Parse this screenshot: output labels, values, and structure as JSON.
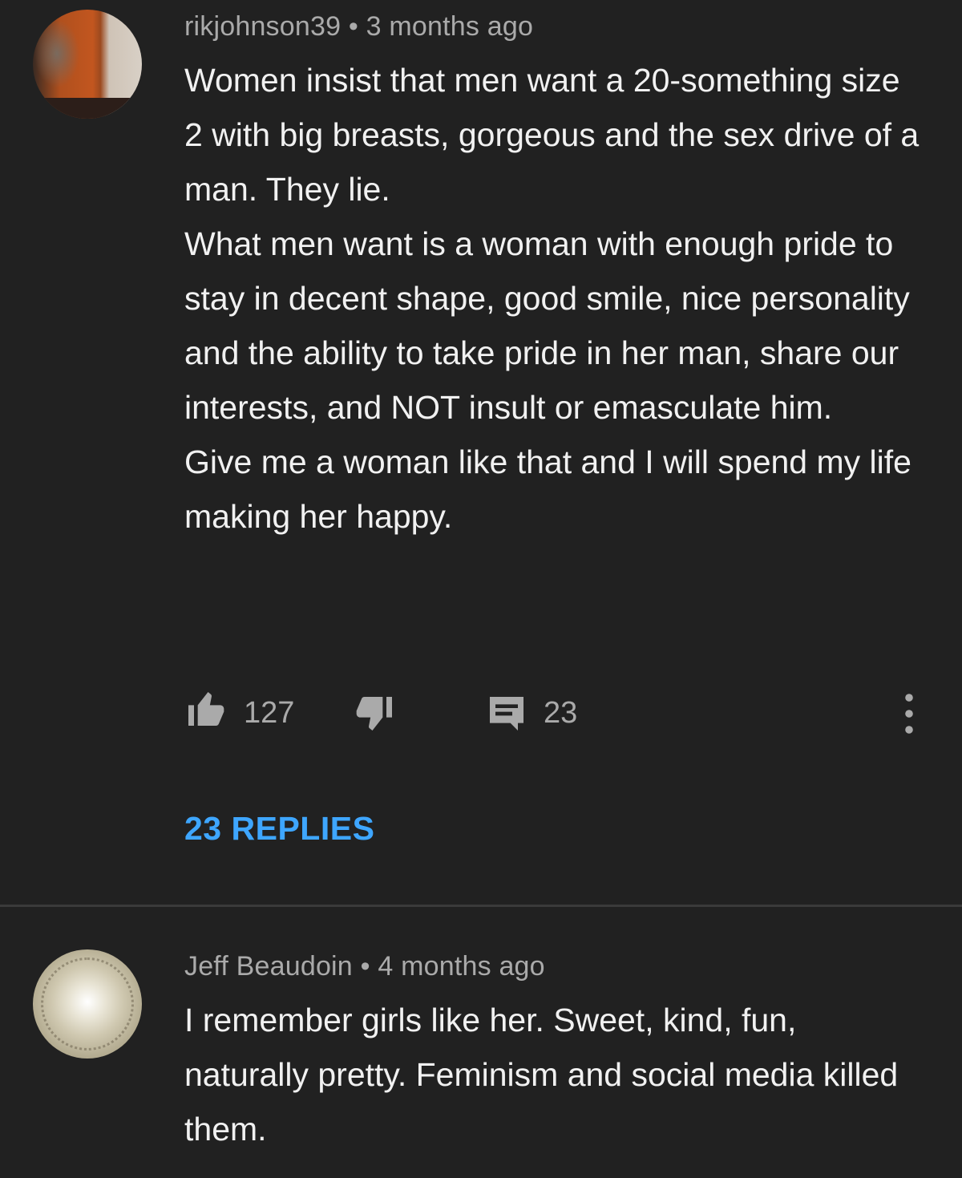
{
  "comments": [
    {
      "author": "rikjohnson39",
      "separator": "•",
      "time": "3 months ago",
      "paragraphs": [
        "Women insist that men want a 20-something size 2 with big breasts, gorgeous and the sex drive of a man.  They lie.",
        "What men want is a woman with enough pride to stay in decent shape, good smile, nice personality and the ability to take pride in her man, share our interests, and NOT insult or emasculate him.",
        "Give me a woman like that and I will spend my life making her happy."
      ],
      "likes": "127",
      "reply_count": "23",
      "replies_label": "23 REPLIES"
    },
    {
      "author": "Jeff Beaudoin",
      "separator": "•",
      "time": "4 months ago",
      "paragraphs": [
        "I remember girls like her. Sweet, kind, fun, naturally pretty. Feminism and social media killed them."
      ]
    }
  ],
  "icons": {
    "like": "thumb-up-icon",
    "dislike": "thumb-down-icon",
    "reply": "comment-icon",
    "more": "more-vertical-icon"
  },
  "colors": {
    "background": "#212121",
    "text": "#f1f1f1",
    "meta": "#aaaaaa",
    "link": "#3ea6ff"
  }
}
